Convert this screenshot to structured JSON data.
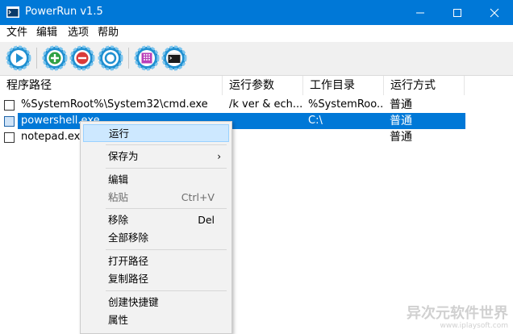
{
  "window": {
    "title": "PowerRun v1.5",
    "title_color": "#0078d7"
  },
  "menu": [
    "文件",
    "编辑",
    "选项",
    "帮助"
  ],
  "toolbar": {
    "buttons": [
      {
        "icon": "run-icon"
      },
      {
        "icon": "add-icon"
      },
      {
        "icon": "remove-icon"
      },
      {
        "icon": "refresh-icon"
      },
      {
        "icon": "grid-icon"
      },
      {
        "icon": "cmd-icon"
      }
    ]
  },
  "table": {
    "columns": [
      "程序路径",
      "运行参数",
      "工作目录",
      "运行方式"
    ],
    "rows": [
      {
        "path": "%SystemRoot%\\System32\\cmd.exe",
        "args": "/k ver & ech...",
        "dir": "%SystemRoo...",
        "mode": "普通",
        "selected": false
      },
      {
        "path": "powershell.exe",
        "args": "",
        "dir": "C:\\",
        "mode": "普通",
        "selected": true
      },
      {
        "path": "notepad.exe",
        "args": "",
        "dir": "",
        "mode": "普通",
        "selected": false
      }
    ]
  },
  "context_menu": {
    "items": [
      {
        "label": "运行",
        "shortcut": "",
        "hover": true
      },
      {
        "label": "保存为",
        "shortcut": "",
        "submenu": true
      },
      {
        "label": "编辑",
        "shortcut": ""
      },
      {
        "label": "粘贴",
        "shortcut": "Ctrl+V",
        "disabled": true
      },
      {
        "label": "移除",
        "shortcut": "Del"
      },
      {
        "label": "全部移除",
        "shortcut": ""
      },
      {
        "label": "打开路径",
        "shortcut": ""
      },
      {
        "label": "复制路径",
        "shortcut": ""
      },
      {
        "label": "创建快捷键",
        "shortcut": ""
      },
      {
        "label": "属性",
        "shortcut": ""
      }
    ],
    "submenu_arrow": "›"
  },
  "watermark": {
    "main": "异次元软件世界",
    "url": "www.iplaysoft.com"
  }
}
